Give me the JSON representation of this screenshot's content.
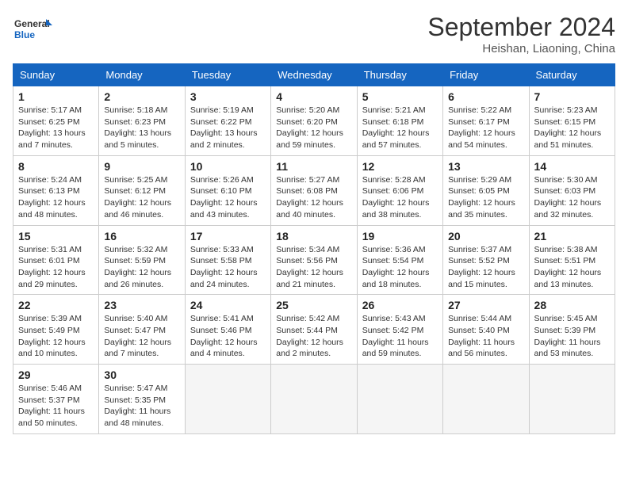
{
  "logo": {
    "general": "General",
    "blue": "Blue"
  },
  "header": {
    "month_year": "September 2024",
    "location": "Heishan, Liaoning, China"
  },
  "days_of_week": [
    "Sunday",
    "Monday",
    "Tuesday",
    "Wednesday",
    "Thursday",
    "Friday",
    "Saturday"
  ],
  "weeks": [
    [
      {
        "day": "1",
        "info": "Sunrise: 5:17 AM\nSunset: 6:25 PM\nDaylight: 13 hours\nand 7 minutes."
      },
      {
        "day": "2",
        "info": "Sunrise: 5:18 AM\nSunset: 6:23 PM\nDaylight: 13 hours\nand 5 minutes."
      },
      {
        "day": "3",
        "info": "Sunrise: 5:19 AM\nSunset: 6:22 PM\nDaylight: 13 hours\nand 2 minutes."
      },
      {
        "day": "4",
        "info": "Sunrise: 5:20 AM\nSunset: 6:20 PM\nDaylight: 12 hours\nand 59 minutes."
      },
      {
        "day": "5",
        "info": "Sunrise: 5:21 AM\nSunset: 6:18 PM\nDaylight: 12 hours\nand 57 minutes."
      },
      {
        "day": "6",
        "info": "Sunrise: 5:22 AM\nSunset: 6:17 PM\nDaylight: 12 hours\nand 54 minutes."
      },
      {
        "day": "7",
        "info": "Sunrise: 5:23 AM\nSunset: 6:15 PM\nDaylight: 12 hours\nand 51 minutes."
      }
    ],
    [
      {
        "day": "8",
        "info": "Sunrise: 5:24 AM\nSunset: 6:13 PM\nDaylight: 12 hours\nand 48 minutes."
      },
      {
        "day": "9",
        "info": "Sunrise: 5:25 AM\nSunset: 6:12 PM\nDaylight: 12 hours\nand 46 minutes."
      },
      {
        "day": "10",
        "info": "Sunrise: 5:26 AM\nSunset: 6:10 PM\nDaylight: 12 hours\nand 43 minutes."
      },
      {
        "day": "11",
        "info": "Sunrise: 5:27 AM\nSunset: 6:08 PM\nDaylight: 12 hours\nand 40 minutes."
      },
      {
        "day": "12",
        "info": "Sunrise: 5:28 AM\nSunset: 6:06 PM\nDaylight: 12 hours\nand 38 minutes."
      },
      {
        "day": "13",
        "info": "Sunrise: 5:29 AM\nSunset: 6:05 PM\nDaylight: 12 hours\nand 35 minutes."
      },
      {
        "day": "14",
        "info": "Sunrise: 5:30 AM\nSunset: 6:03 PM\nDaylight: 12 hours\nand 32 minutes."
      }
    ],
    [
      {
        "day": "15",
        "info": "Sunrise: 5:31 AM\nSunset: 6:01 PM\nDaylight: 12 hours\nand 29 minutes."
      },
      {
        "day": "16",
        "info": "Sunrise: 5:32 AM\nSunset: 5:59 PM\nDaylight: 12 hours\nand 26 minutes."
      },
      {
        "day": "17",
        "info": "Sunrise: 5:33 AM\nSunset: 5:58 PM\nDaylight: 12 hours\nand 24 minutes."
      },
      {
        "day": "18",
        "info": "Sunrise: 5:34 AM\nSunset: 5:56 PM\nDaylight: 12 hours\nand 21 minutes."
      },
      {
        "day": "19",
        "info": "Sunrise: 5:36 AM\nSunset: 5:54 PM\nDaylight: 12 hours\nand 18 minutes."
      },
      {
        "day": "20",
        "info": "Sunrise: 5:37 AM\nSunset: 5:52 PM\nDaylight: 12 hours\nand 15 minutes."
      },
      {
        "day": "21",
        "info": "Sunrise: 5:38 AM\nSunset: 5:51 PM\nDaylight: 12 hours\nand 13 minutes."
      }
    ],
    [
      {
        "day": "22",
        "info": "Sunrise: 5:39 AM\nSunset: 5:49 PM\nDaylight: 12 hours\nand 10 minutes."
      },
      {
        "day": "23",
        "info": "Sunrise: 5:40 AM\nSunset: 5:47 PM\nDaylight: 12 hours\nand 7 minutes."
      },
      {
        "day": "24",
        "info": "Sunrise: 5:41 AM\nSunset: 5:46 PM\nDaylight: 12 hours\nand 4 minutes."
      },
      {
        "day": "25",
        "info": "Sunrise: 5:42 AM\nSunset: 5:44 PM\nDaylight: 12 hours\nand 2 minutes."
      },
      {
        "day": "26",
        "info": "Sunrise: 5:43 AM\nSunset: 5:42 PM\nDaylight: 11 hours\nand 59 minutes."
      },
      {
        "day": "27",
        "info": "Sunrise: 5:44 AM\nSunset: 5:40 PM\nDaylight: 11 hours\nand 56 minutes."
      },
      {
        "day": "28",
        "info": "Sunrise: 5:45 AM\nSunset: 5:39 PM\nDaylight: 11 hours\nand 53 minutes."
      }
    ],
    [
      {
        "day": "29",
        "info": "Sunrise: 5:46 AM\nSunset: 5:37 PM\nDaylight: 11 hours\nand 50 minutes."
      },
      {
        "day": "30",
        "info": "Sunrise: 5:47 AM\nSunset: 5:35 PM\nDaylight: 11 hours\nand 48 minutes."
      },
      {
        "day": "",
        "info": ""
      },
      {
        "day": "",
        "info": ""
      },
      {
        "day": "",
        "info": ""
      },
      {
        "day": "",
        "info": ""
      },
      {
        "day": "",
        "info": ""
      }
    ]
  ]
}
